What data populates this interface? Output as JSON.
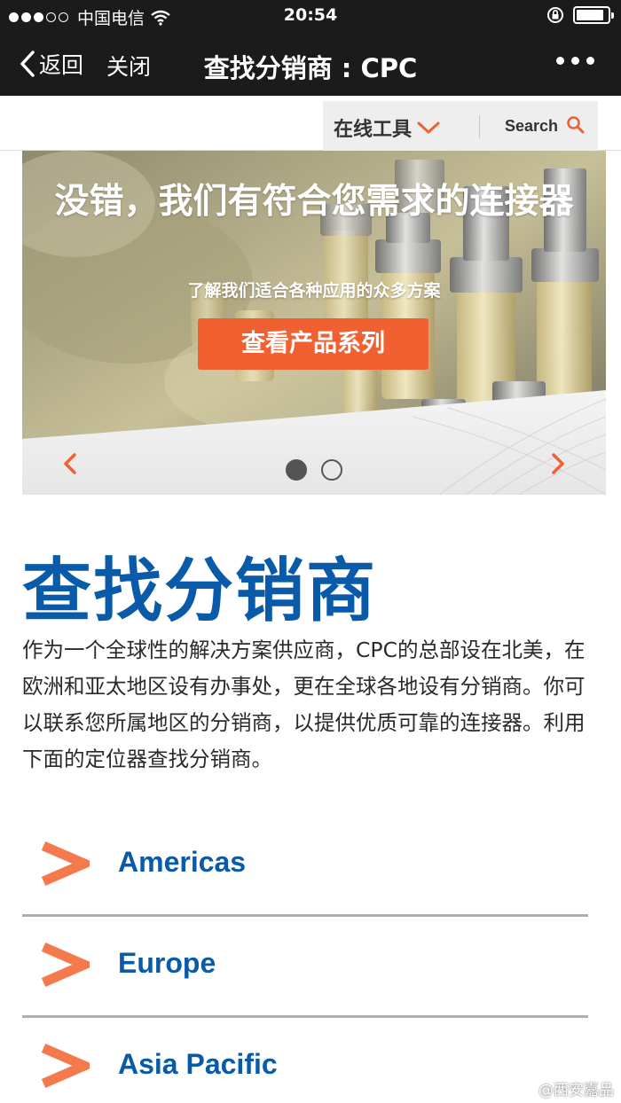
{
  "status_bar": {
    "carrier": "中国电信",
    "time": "20:54"
  },
  "nav": {
    "back_label": "返回",
    "close_label": "关闭",
    "title": "查找分销商 : CPC"
  },
  "tools_header": {
    "menu_label": "在线工具",
    "search_label": "Search"
  },
  "hero": {
    "title": "没错，我们有符合您需求的连接器",
    "subtitle": "了解我们适合各种应用的众多方案",
    "cta_label": "查看产品系列",
    "slide_count": 2,
    "active_slide": 1
  },
  "main": {
    "title": "查找分销商",
    "intro": "作为一个全球性的解决方案供应商，CPC的总部设在北美，在欧洲和亚太地区设有办事处，更在全球各地设有分销商。你可以联系您所属地区的分销商，以提供优质可靠的连接器。利用下面的定位器查找分销商。"
  },
  "regions": [
    {
      "label": "Americas"
    },
    {
      "label": "Europe"
    },
    {
      "label": "Asia Pacific"
    }
  ],
  "watermark": "@西安嘉品",
  "colors": {
    "accent_orange": "#f06030",
    "brand_blue": "#0a5aaa",
    "nav_background": "#1b1b1b"
  }
}
